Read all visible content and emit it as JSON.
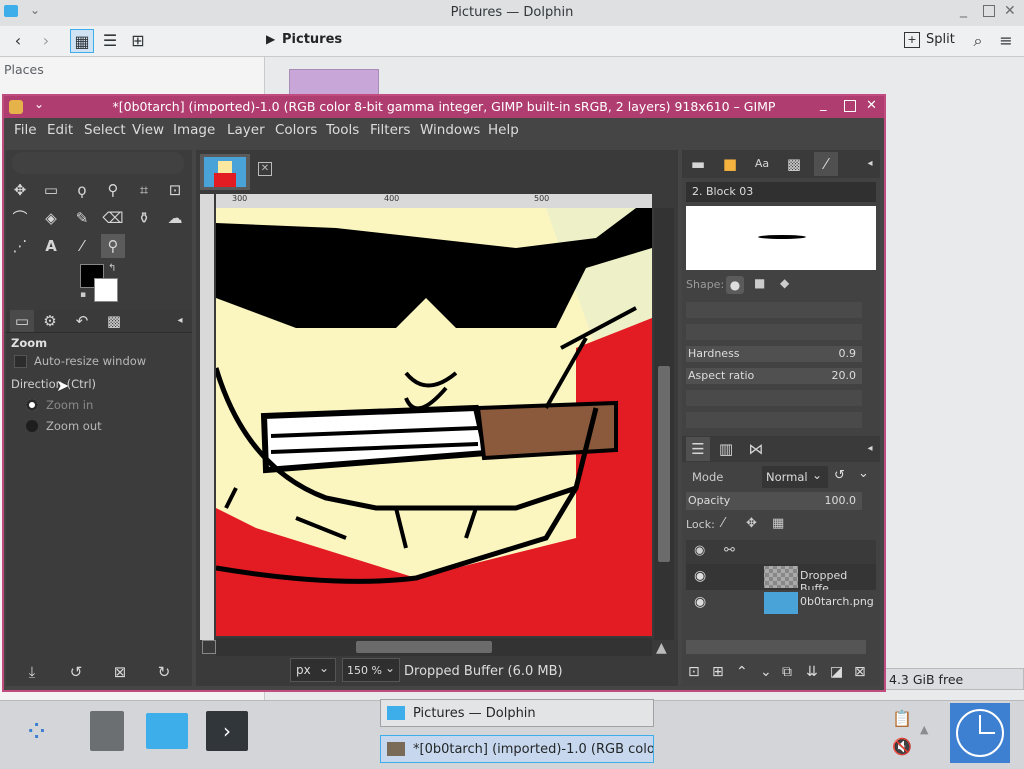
{
  "dolphin": {
    "title": "Pictures — Dolphin",
    "breadcrumb": "Pictures",
    "split_label": "Split",
    "places_label": "Places",
    "free_space": "4.3 GiB free"
  },
  "gimp": {
    "title": "*[0b0tarch] (imported)-1.0 (RGB color 8-bit gamma integer, GIMP built-in sRGB, 2 layers) 918x610 – GIMP",
    "menu": [
      "File",
      "Edit",
      "Select",
      "View",
      "Image",
      "Layer",
      "Colors",
      "Tools",
      "Filters",
      "Windows",
      "Help"
    ],
    "tool_options": {
      "title": "Zoom",
      "auto_resize": "Auto-resize window",
      "direction": "Direction (Ctrl)",
      "zoom_in": "Zoom in",
      "zoom_out": "Zoom out"
    },
    "ruler_labels": [
      "300",
      "400",
      "500"
    ],
    "status": {
      "unit": "px",
      "zoom": "150 %",
      "message": "Dropped Buffer (6.0 MB)"
    },
    "brush": {
      "name": "2. Block 03",
      "shape_label": "Shape:",
      "hardness_label": "Hardness",
      "hardness_value": "0.9",
      "aspect_label": "Aspect ratio",
      "aspect_value": "20.0"
    },
    "layers": {
      "mode_label": "Mode",
      "mode_value": "Normal",
      "opacity_label": "Opacity",
      "opacity_value": "100.0",
      "lock_label": "Lock:",
      "items": [
        {
          "name": "Dropped Buffe"
        },
        {
          "name": "0b0tarch.png"
        }
      ]
    }
  },
  "taskbar": {
    "tasks": [
      {
        "label": "Pictures — Dolphin"
      },
      {
        "label": "*[0b0tarch] (imported)-1.0 (RGB colo..."
      }
    ]
  },
  "colors": {
    "gimp_border": "#c04c80",
    "canvas_yellow": "#fbf6c0",
    "shirt_red": "#e31b23"
  }
}
